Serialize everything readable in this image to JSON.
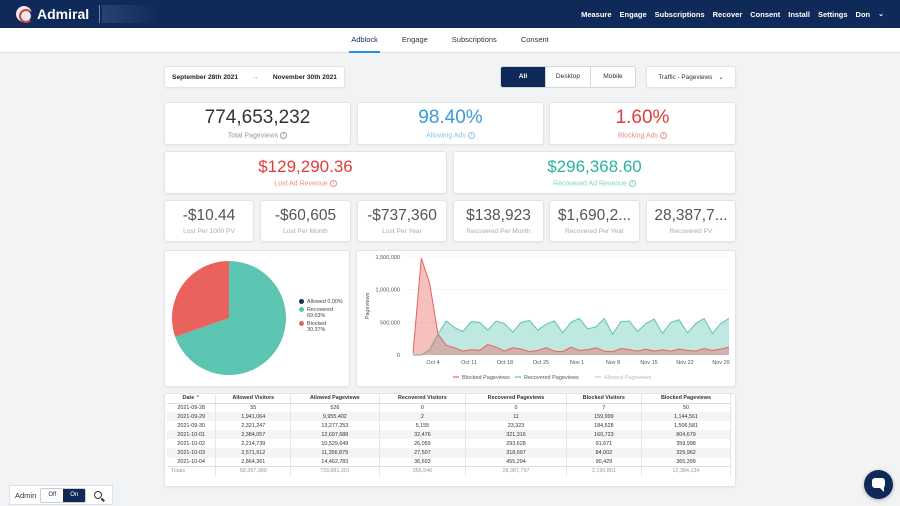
{
  "brand": {
    "name": "Admiral"
  },
  "topnav": [
    "Measure",
    "Engage",
    "Subscriptions",
    "Recover",
    "Consent",
    "Install",
    "Settings",
    "Don"
  ],
  "subnav": {
    "tabs": [
      "Adblock",
      "Engage",
      "Subscriptions",
      "Consent"
    ],
    "active": "Adblock"
  },
  "filters": {
    "start": "September 28th 2021",
    "arrow": "→",
    "end": "November 30th 2021",
    "devices": [
      "All",
      "Desktop",
      "Mobile"
    ],
    "active_device": "All",
    "traffic": "Traffic - Pageviews"
  },
  "metrics": {
    "total_pageviews": {
      "value": "774,653,232",
      "label": "Total Pageviews"
    },
    "allowing_ads": {
      "value": "98.40%",
      "label": "Allowing Ads",
      "color": "#3a9ad9"
    },
    "blocking_ads": {
      "value": "1.60%",
      "label": "Blocking Ads",
      "color": "#e23b3b"
    },
    "lost_revenue": {
      "value": "$129,290.36",
      "label": "Lost Ad Revenue",
      "color": "#e23b3b"
    },
    "recovered_revenue": {
      "value": "$296,368.60",
      "label": "Recovered Ad Revenue",
      "color": "#2bb3a0"
    }
  },
  "small_metrics": [
    {
      "value": "-$10.44",
      "label": "Lost Per 1000 PV"
    },
    {
      "value": "-$60,605",
      "label": "Lost Per Month"
    },
    {
      "value": "-$737,360",
      "label": "Lost Per Year"
    },
    {
      "value": "$138,923",
      "label": "Recovered Per Month"
    },
    {
      "value": "$1,690,2...",
      "label": "Recovered Per Year"
    },
    {
      "value": "28,387,7...",
      "label": "Recovered PV"
    }
  ],
  "pie": {
    "legend": [
      {
        "name": "Allowed",
        "pct": "0.00%",
        "color": "#1c2f5a"
      },
      {
        "name": "Recovered",
        "pct": "69.63%",
        "color": "#5cc5b2"
      },
      {
        "name": "Blocked",
        "pct": "30.37%",
        "color": "#e9625d"
      }
    ]
  },
  "chart_data": {
    "type": "area",
    "ylabel": "Pageviews",
    "yticks": [
      "1,500,000",
      "1,000,000",
      "500,000",
      "0"
    ],
    "ylim": [
      0,
      1500000
    ],
    "x": [
      "Oct 4",
      "Oct 11",
      "Oct 18",
      "Oct 25",
      "Nov 1",
      "Nov 8",
      "Nov 15",
      "Nov 22",
      "Nov 29"
    ],
    "series": [
      {
        "name": "Blocked Pageviews",
        "color": "#e9625d",
        "values": [
          30000,
          1480000,
          1100000,
          320000,
          150000,
          110000,
          60000,
          80000,
          70000,
          160000,
          120000,
          60000,
          110000,
          90000,
          50000,
          70000,
          110000,
          60000,
          50000,
          120000,
          70000,
          80000,
          110000,
          60000,
          50000,
          100000,
          80000,
          60000,
          90000,
          60000,
          80000,
          60000,
          90000,
          70000,
          60000,
          100000,
          70000,
          90000,
          120000
        ]
      },
      {
        "name": "Recovered Pageviews",
        "color": "#5cc5b2",
        "values": [
          0,
          0,
          80000,
          320000,
          520000,
          420000,
          360000,
          510000,
          500000,
          380000,
          520000,
          480000,
          350000,
          500000,
          530000,
          380000,
          470000,
          520000,
          340000,
          500000,
          560000,
          400000,
          430000,
          560000,
          320000,
          510000,
          520000,
          360000,
          480000,
          550000,
          330000,
          500000,
          540000,
          340000,
          480000,
          560000,
          330000,
          480000,
          560000
        ]
      },
      {
        "name": "Allowed Pageviews",
        "color": "#cccccc",
        "values": []
      }
    ]
  },
  "table": {
    "headers": [
      "Date",
      "Allowed Visitors",
      "Allowed Pageviews",
      "Recovered Visitors",
      "Recovered Pageviews",
      "Blocked Visitors",
      "Blocked Pageviews"
    ],
    "rows": [
      [
        "2021-09-28",
        "55",
        "526",
        "0",
        "0",
        "7",
        "50"
      ],
      [
        "2021-09-29",
        "1,941,064",
        "9,955,402",
        "2",
        "11",
        "159,999",
        "1,144,561"
      ],
      [
        "2021-09-30",
        "2,321,247",
        "13,277,253",
        "5,155",
        "23,323",
        "184,528",
        "1,506,581"
      ],
      [
        "2021-10-01",
        "2,384,057",
        "12,697,688",
        "32,476",
        "321,316",
        "160,723",
        "804,679"
      ],
      [
        "2021-10-02",
        "2,214,739",
        "10,529,649",
        "26,059",
        "293,628",
        "91,671",
        "359,998"
      ],
      [
        "2021-10-03",
        "2,571,912",
        "11,356,879",
        "27,507",
        "318,697",
        "84,002",
        "329,962"
      ],
      [
        "2021-10-04",
        "2,864,361",
        "14,462,783",
        "36,693",
        "455,294",
        "90,429",
        "365,399"
      ]
    ],
    "totals": [
      "Totals",
      "58,397,389",
      "733,881,301",
      "356,546",
      "28,387,797",
      "2,190,801",
      "12,384,134"
    ]
  },
  "admin": {
    "label": "Admin",
    "off": "Off",
    "on": "On"
  }
}
